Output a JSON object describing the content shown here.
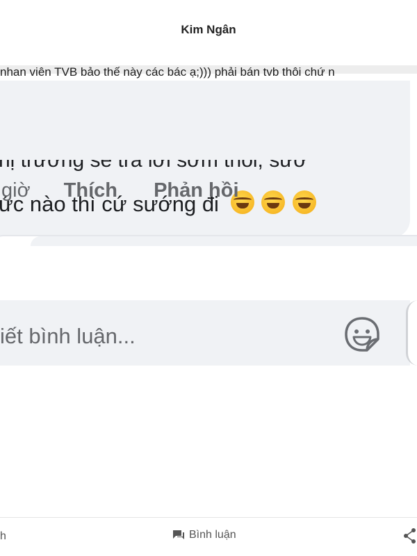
{
  "header": {
    "title": "Kim Ngân"
  },
  "post": {
    "caption": "nhan  viên TVB bảo thế này các bác ạ;))) phải bán tvb thôi chứ n"
  },
  "comment": {
    "line1_partial": "hị trường sẽ trả lời sớm thôi, sướ",
    "line2": "ức nào thì cứ sướng đi",
    "emojis": [
      "laughing-tears-emoji",
      "laughing-tears-emoji",
      "laughing-tears-emoji"
    ]
  },
  "actions": {
    "time": "giờ",
    "like": "Thích",
    "reply": "Phản hồi"
  },
  "composer": {
    "placeholder": "iết bình luận...",
    "sticker_icon": "sticker-icon"
  },
  "bottom_bar": {
    "left_label": "h",
    "comment_label": "Bình luận",
    "comment_icon": "comment-icon",
    "share_icon": "share-icon"
  },
  "colors": {
    "bubble_bg": "#f0f2f5",
    "action_text": "#65676b",
    "text": "#1c1e21"
  }
}
